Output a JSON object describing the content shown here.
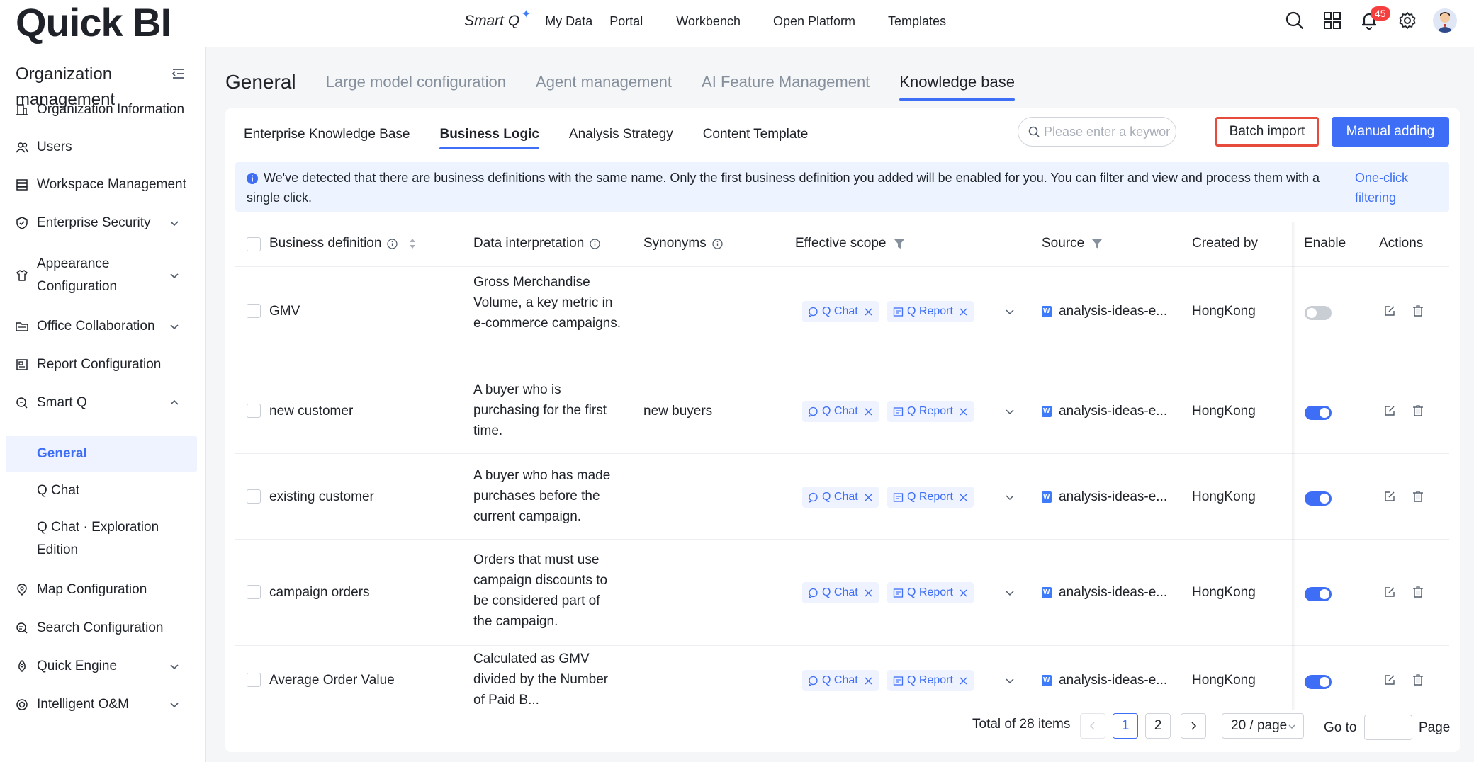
{
  "app": {
    "logo": "Quick BI"
  },
  "topnav": {
    "smartq": "Smart Q",
    "items": [
      "My Data",
      "Portal",
      "Workbench",
      "Open Platform",
      "Templates"
    ],
    "notification_count": "45"
  },
  "sidebar": {
    "title": "Organization management",
    "items": [
      {
        "label": "Organization Information"
      },
      {
        "label": "Users"
      },
      {
        "label": "Workspace Management"
      },
      {
        "label": "Enterprise Security"
      },
      {
        "label": "Appearance Configuration"
      },
      {
        "label": "Office Collaboration"
      },
      {
        "label": "Report Configuration"
      },
      {
        "label": "Smart Q"
      },
      {
        "label": "Map Configuration"
      },
      {
        "label": "Search Configuration"
      },
      {
        "label": "Quick Engine"
      },
      {
        "label": "Intelligent O&M"
      }
    ],
    "smartq_sub": [
      "General",
      "Q Chat",
      "Q Chat · Exploration Edition"
    ]
  },
  "section": {
    "title": "General",
    "tabs": [
      "Large model configuration",
      "Agent management",
      "AI Feature Management",
      "Knowledge base"
    ]
  },
  "subtabs": [
    "Enterprise Knowledge Base",
    "Business Logic",
    "Analysis Strategy",
    "Content Template"
  ],
  "search": {
    "placeholder": "Please enter a keyword."
  },
  "buttons": {
    "batch_import": "Batch import",
    "manual_adding": "Manual adding"
  },
  "alert": {
    "message": "We've detected that there are business definitions with the same name. Only the first business definition you added will be enabled for you. You can filter and view and process them with a single click.",
    "link": "One-click filtering"
  },
  "table": {
    "columns": {
      "business_definition": "Business definition",
      "data_interpretation": "Data interpretation",
      "synonyms": "Synonyms",
      "effective_scope": "Effective scope",
      "source": "Source",
      "created_by": "Created by",
      "enable": "Enable",
      "actions": "Actions"
    },
    "tag_qchat": "Q Chat",
    "tag_qreport": "Q Report",
    "rows": [
      {
        "definition": "GMV",
        "interpretation": "Gross Merchandise Volume, a key metric in e-commerce campaigns.",
        "synonyms": "",
        "source": "analysis-ideas-e...",
        "created_by": "HongKong",
        "enabled": false
      },
      {
        "definition": "new customer",
        "interpretation": "A buyer who is purchasing for the first time.",
        "synonyms": "new buyers",
        "source": "analysis-ideas-e...",
        "created_by": "HongKong",
        "enabled": true
      },
      {
        "definition": "existing customer",
        "interpretation": "A buyer who has made purchases before the current campaign.",
        "synonyms": "",
        "source": "analysis-ideas-e...",
        "created_by": "HongKong",
        "enabled": true
      },
      {
        "definition": "campaign orders",
        "interpretation": "Orders that must use campaign discounts to be considered part of the campaign.",
        "synonyms": "",
        "source": "analysis-ideas-e...",
        "created_by": "HongKong",
        "enabled": true
      },
      {
        "definition": "Average Order Value",
        "interpretation": "Calculated as GMV divided by the Number of Paid B...",
        "synonyms": "",
        "source": "analysis-ideas-e...",
        "created_by": "HongKong",
        "enabled": true
      }
    ]
  },
  "pagination": {
    "total": "Total of 28 items",
    "pages": [
      "1",
      "2"
    ],
    "page_size": "20 / page",
    "goto": "Go to",
    "page": "Page"
  }
}
